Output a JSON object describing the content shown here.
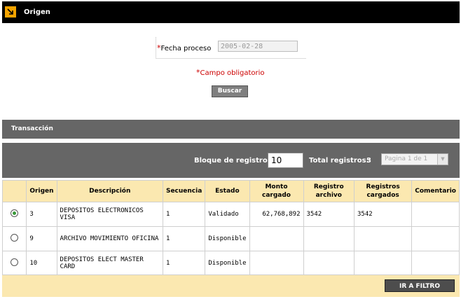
{
  "origen": {
    "title": "Origen"
  },
  "filter": {
    "fecha_label": "Fecha proceso",
    "fecha_value": "2005-02-28",
    "obligatorio_label": "Campo obligatorio",
    "buscar_label": "Buscar"
  },
  "transaccion": {
    "title": "Transacción",
    "bloque_label": "Bloque de registros:",
    "bloque_value": "10",
    "total_label": "Total registros:",
    "total_value": "3",
    "pagina_value": "Pagina 1 de 1"
  },
  "table": {
    "headers": [
      "",
      "Origen",
      "Descripción",
      "Secuencia",
      "Estado",
      "Monto cargado",
      "Registro archivo",
      "Registros cargados",
      "Comentario"
    ],
    "rows": [
      {
        "selected": true,
        "origen": "3",
        "descripcion": "DEPOSITOS ELECTRONICOS VISA",
        "secuencia": "1",
        "estado": "Validado",
        "monto": "62,768,892",
        "registro_archivo": "3542",
        "registros_cargados": "3542",
        "comentario": ""
      },
      {
        "selected": false,
        "origen": "9",
        "descripcion": "ARCHIVO MOVIMIENTO OFICINA",
        "secuencia": "1",
        "estado": "Disponible",
        "monto": "",
        "registro_archivo": "",
        "registros_cargados": "",
        "comentario": ""
      },
      {
        "selected": false,
        "origen": "10",
        "descripcion": "DEPOSITOS ELECT MASTER CARD",
        "secuencia": "1",
        "estado": "Disponible",
        "monto": "",
        "registro_archivo": "",
        "registros_cargados": "",
        "comentario": ""
      }
    ]
  },
  "footer": {
    "ir_filtro_label": "IR A FILTRO"
  },
  "colors": {
    "header_black": "#000000",
    "header_gray": "#666666",
    "accent_orange": "#f5a400",
    "table_header_bg": "#fbe8b0",
    "required_red": "#cc0000"
  }
}
